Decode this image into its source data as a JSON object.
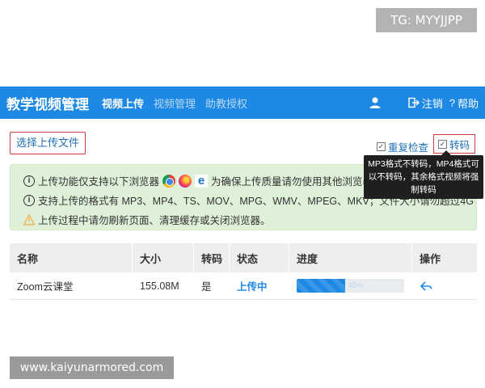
{
  "watermarks": {
    "top": "TG: MYYJJPP",
    "bottom": "www.kaiyunarmored.com"
  },
  "header": {
    "title": "教学视频管理",
    "nav": [
      "视频上传",
      "视频管理",
      "助教授权"
    ],
    "logout": "注销",
    "help": "帮助"
  },
  "toolbar": {
    "upload_button": "选择上传文件",
    "duplicate_check": "重复检查",
    "transcode": "转码"
  },
  "tooltip": {
    "text": "MP3格式不转码，MP4格式可以不转码，其余格式视频将强制转码"
  },
  "notice": {
    "line1_prefix": "上传功能仅支持以下浏览器",
    "line1_suffix": "为确保上传质量请勿使用其他浏览器",
    "line2": "支持上传的格式有 MP3、MP4、TS、MOV、MPG、WMV、MPEG、MKV；文件大小请勿超过4G",
    "line3": "上传过程中请勿刷新页面、清理缓存或关闭浏览器。"
  },
  "table": {
    "headers": [
      "名称",
      "大小",
      "转码",
      "状态",
      "进度",
      "操作"
    ],
    "rows": [
      {
        "name": "Zoom云课堂",
        "size": "155.08M",
        "transcode": "是",
        "status": "上传中",
        "progress": 0.45,
        "progress_label": "45%"
      }
    ]
  },
  "colors": {
    "header_bg": "#1e88e5",
    "notice_bg": "#dff0d8",
    "highlight_border": "#d13b3b",
    "link": "#1e88e5"
  },
  "icons": [
    "user-icon",
    "logout-icon",
    "help-icon",
    "info-icon",
    "warning-icon",
    "chrome-icon",
    "firefox-icon",
    "edge-icon",
    "cancel-icon"
  ]
}
